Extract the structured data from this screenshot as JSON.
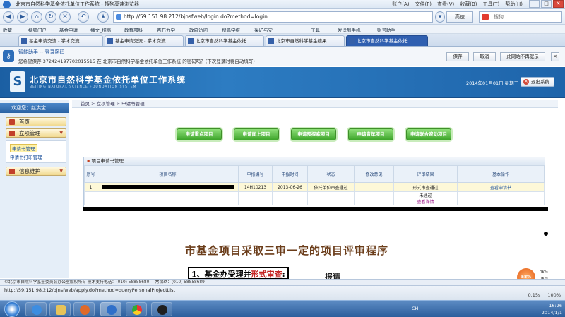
{
  "window": {
    "title": "北京市自然科学基金依托单位工作系统 - 搜狗高速浏览器",
    "menus": [
      "账户(A)",
      "文件(F)",
      "查看(V)",
      "收藏(B)",
      "工具(T)",
      "帮助(H)"
    ],
    "min": "–",
    "max": "□",
    "close": "✕"
  },
  "nav": {
    "url": "http://59.151.98.212/bjnsfweb/login.do?method=login",
    "go_label": "高速",
    "search_placeholder": "搜狗"
  },
  "favorites": [
    "收藏",
    "搜狐门户",
    "基金申请",
    "播文_招商",
    "教育部科",
    "百石力学",
    "政府访问",
    "搜狐学报",
    "采矿与安",
    "工具",
    "发送到手机",
    "账号助手"
  ],
  "tabs": [
    {
      "label": "基金申请交流 - 学术交流..."
    },
    {
      "label": "基金申请交流 - 学术交流..."
    },
    {
      "label": "北京市自然科学基金依托..."
    },
    {
      "label": "北京市自然科学基金结果..."
    },
    {
      "label": "北京市自然科学基金依托..."
    }
  ],
  "password_prompt": {
    "title": "智能助手 -- 登录密码",
    "message": "您希望保存 372424197702015515 在 北京市自然科学基金依托单位工作系统 的密码吗？(下次登录时将自动填写)",
    "save": "保存",
    "cancel": "取消",
    "never": "此网站不再提示"
  },
  "site": {
    "name": "北京市自然科学基金依托单位工作系统",
    "pinyin": "BEIJING NATURAL SCIENCE FOUNDATION SYSTEM",
    "logo_letter": "S",
    "date": "2014年01月01日 星期三",
    "logout": "退出系统"
  },
  "sidebar": {
    "welcome": "欢迎您：赵洪宝",
    "home": "首页",
    "project_mgmt": "立项管理",
    "sub1": "申请书管理",
    "sub2": "申请书打印管理",
    "info_maint": "信息维护"
  },
  "breadcrumb": "首页 > 立项管理 > 申请书管理",
  "action_buttons": [
    "申请重点项目",
    "申请面上项目",
    "申请预探索项目",
    "申请青年项目",
    "申请联合资助项目"
  ],
  "table": {
    "panel_title": "项目申请书管理",
    "headers": [
      "序号",
      "项目名称",
      "申报编号",
      "申报时间",
      "状态",
      "修改意见",
      "评审结果",
      "基本操作"
    ],
    "rows": [
      {
        "no": "1",
        "code": "14H10213",
        "date": "2013-06-26",
        "status": "依托单位审查通过",
        "opinion": "",
        "result": "形式审查通过",
        "op": "查看申请书"
      },
      {
        "no": "",
        "code": "",
        "date": "",
        "status": "",
        "opinion": "",
        "result": "未通过",
        "op": "查看详情"
      }
    ]
  },
  "slide": {
    "title": "市基金项目采取三审一定的项目评审程序",
    "step_prefix": "1、基金办受理并",
    "step_red": "形式审查",
    "step_suffix": ":",
    "report": "报请"
  },
  "footer": "©北京市自然科学基金委员会办公室版权所有 技术支持电话：(010) 58858680----常宿玖：(010) 58858689",
  "status": {
    "url": "http://59.151.98.212/bjnsfweb/apply.do?method=queryPersonalProjectList",
    "speed": "0.15s",
    "zoom": "100%",
    "speed_widget": "58%",
    "net_up": "0K/s",
    "net_down": "0K/s"
  },
  "taskbar": {
    "lang": "CH",
    "time": "16:26",
    "date": "2014/1/1"
  }
}
